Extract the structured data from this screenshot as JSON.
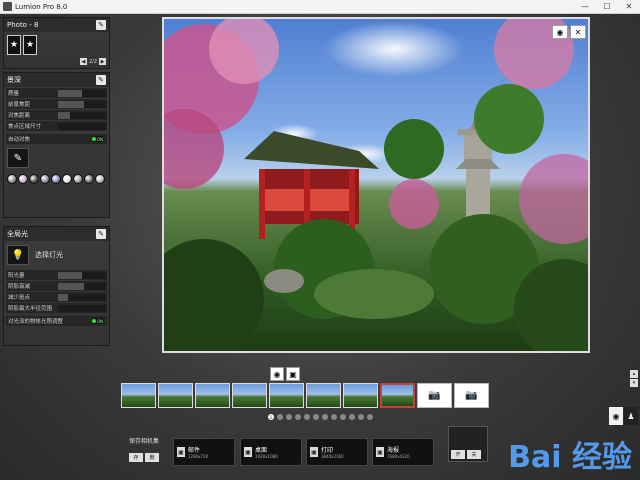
{
  "window": {
    "title": "Lumion Pro 8.0",
    "controls": [
      "—",
      "☐",
      "✕"
    ]
  },
  "photo_panel": {
    "title": "Photo - 8",
    "thumbs": [
      "★",
      "★"
    ],
    "pager": {
      "prev": "◀",
      "text": "2/2",
      "next": "▶"
    }
  },
  "scene_panel": {
    "title": "景深",
    "rows": [
      {
        "label": "质量",
        "fill": 0.5
      },
      {
        "label": "前景焦距",
        "fill": 0.55
      },
      {
        "label": "对焦距离",
        "fill": 0.25
      },
      {
        "label": "焦点区域尺寸",
        "fill": 0
      }
    ],
    "toggle_row": {
      "label": "自动对焦",
      "state": "ON"
    },
    "spheres": [
      "#9a9a9a",
      "#d0b0d0",
      "#555555",
      "#9090a0",
      "#8888cc",
      "#e8e8e8",
      "#a0a0a0",
      "#777777",
      "#bbbbbb"
    ]
  },
  "light_panel": {
    "title": "全局光",
    "select_light": "选择灯光",
    "rows": [
      {
        "label": "阳光量",
        "fill": 0.5
      },
      {
        "label": "阴影衰减",
        "fill": 0.55
      },
      {
        "label": "减少斑点",
        "fill": 0.2
      },
      {
        "label": "阴影最大半径范围",
        "fill": 0
      }
    ],
    "toggle_row": {
      "label": "对光泽的物体光照调整",
      "state": "ON"
    }
  },
  "filmstrip": {
    "count": 8,
    "selected_index": 7,
    "camera_icon": "📷"
  },
  "page_dots": [
    "1",
    "",
    "",
    "",
    "",
    "",
    "",
    "",
    "",
    "",
    "",
    ""
  ],
  "save_set": {
    "label": "保存相机集",
    "buttons": [
      "存",
      "删"
    ]
  },
  "exports": [
    {
      "name": "邮件",
      "res": "1280x720"
    },
    {
      "name": "桌面",
      "res": "1920x1080"
    },
    {
      "name": "打印",
      "res": "3840x2160"
    },
    {
      "name": "海报",
      "res": "7680x4320"
    }
  ],
  "right_box": {
    "buttons": [
      "开",
      "关"
    ]
  },
  "watermark": "Bai 经验"
}
